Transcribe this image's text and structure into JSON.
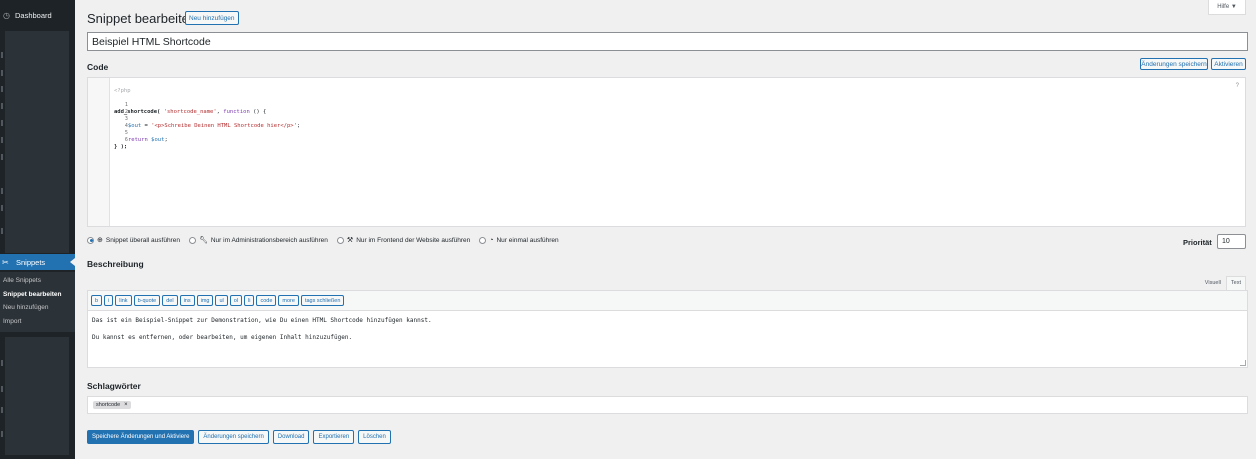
{
  "sidebar": {
    "dashboard": "Dashboard",
    "snippets": "Snippets",
    "submenu": [
      "Alle Snippets",
      "Snippet bearbeiten",
      "Neu hinzufügen",
      "Import"
    ]
  },
  "header": {
    "title": "Snippet bearbeiten",
    "add_new": "Neu hinzufügen",
    "help": "Hilfe ▼"
  },
  "snippet": {
    "name": "Beispiel HTML Shortcode"
  },
  "code": {
    "label": "Code",
    "save_label": "Änderungen speichern",
    "activate_label": "Aktivieren",
    "php_tag": "<?php",
    "help_q": "?",
    "lines": [
      {
        "n": "1",
        "fn": "add_shortcode(",
        "str": " 'shortcode_name'",
        "rest": ",",
        "kw": " function",
        "tail": " () {"
      },
      {
        "n": "2"
      },
      {
        "n": "3",
        "var": "$out",
        "mid": " = ",
        "str": "'<p>Schreibe Deinen HTML Shortcode hier</p>'",
        "tail": ";"
      },
      {
        "n": "4"
      },
      {
        "n": "5",
        "kw": "return",
        "var": " $out",
        "tail": ";"
      },
      {
        "n": "6",
        "fn": "} );"
      }
    ]
  },
  "scope": {
    "options": [
      "Snippet überall ausführen",
      "Nur im Administrationsbereich ausführen",
      "Nur im Frontend der Website ausführen",
      "Nur einmal ausführen"
    ],
    "priority_label": "Priorität",
    "priority_value": "10"
  },
  "description": {
    "label": "Beschreibung",
    "tab_visual": "Visuell",
    "tab_text": "Text",
    "quicktags": [
      "b",
      "i",
      "link",
      "b-quote",
      "del",
      "ins",
      "img",
      "ul",
      "ol",
      "li",
      "code",
      "more",
      "tags schließen"
    ],
    "paragraphs": [
      "Das ist ein Beispiel-Snippet zur Demonstration, wie Du einen HTML Shortcode hinzufügen kannst.",
      "Du kannst es entfernen, oder bearbeiten, um eigenen Inhalt hinzuzufügen."
    ]
  },
  "tags": {
    "label": "Schlagwörter",
    "items": [
      "shortcode"
    ],
    "remove": "×"
  },
  "actions": {
    "save_activate": "Speichere Änderungen und Aktiviere",
    "save": "Änderungen speichern",
    "download": "Download",
    "export": "Exportieren",
    "delete": "Löschen"
  }
}
